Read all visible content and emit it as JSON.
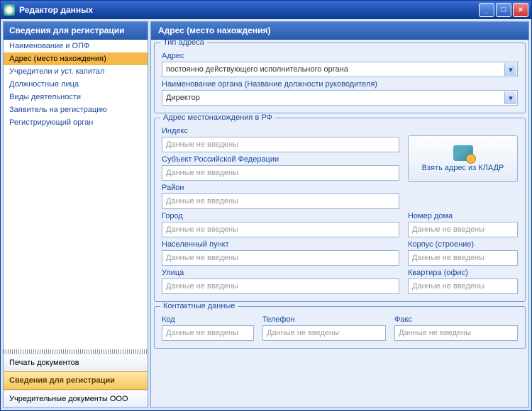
{
  "window": {
    "title": "Редактор данных"
  },
  "sidebar": {
    "header": "Сведения для регистрации",
    "items": [
      {
        "label": "Наименование и ОПФ"
      },
      {
        "label": "Адрес (место нахождения)"
      },
      {
        "label": "Учредители и уст. капитал"
      },
      {
        "label": "Должностные лица"
      },
      {
        "label": "Виды деятельности"
      },
      {
        "label": "Заявитель на регистрацию"
      },
      {
        "label": "Регистрирующий орган"
      }
    ],
    "sections": {
      "print": "Печать документов",
      "reg": "Сведения для регистрации",
      "docs": "Учредительные документы ООО"
    }
  },
  "main": {
    "title": "Адрес (место нахождения)",
    "group_type": {
      "legend": "Тип адреса",
      "address_label": "Адрес",
      "address_value": "постоянно действующего исполнительного органа",
      "organ_label": "Наименование органа (Название должности руководителя)",
      "organ_value": "Директор"
    },
    "group_addr": {
      "legend": "Адрес местонахождения в РФ",
      "placeholder": "Данные не введены",
      "index_label": "Индекс",
      "subject_label": "Субъект Российской Федерации",
      "district_label": "Район",
      "city_label": "Город",
      "locality_label": "Населенный пункт",
      "street_label": "Улица",
      "house_label": "Номер дома",
      "building_label": "Корпус (строение)",
      "flat_label": "Квартира (офис)",
      "kladr_button": "Взять адрес из КЛАДР"
    },
    "group_contact": {
      "legend": "Контактные данные",
      "code_label": "Код",
      "phone_label": "Телефон",
      "fax_label": "Факс",
      "placeholder": "Данные не введены"
    }
  }
}
